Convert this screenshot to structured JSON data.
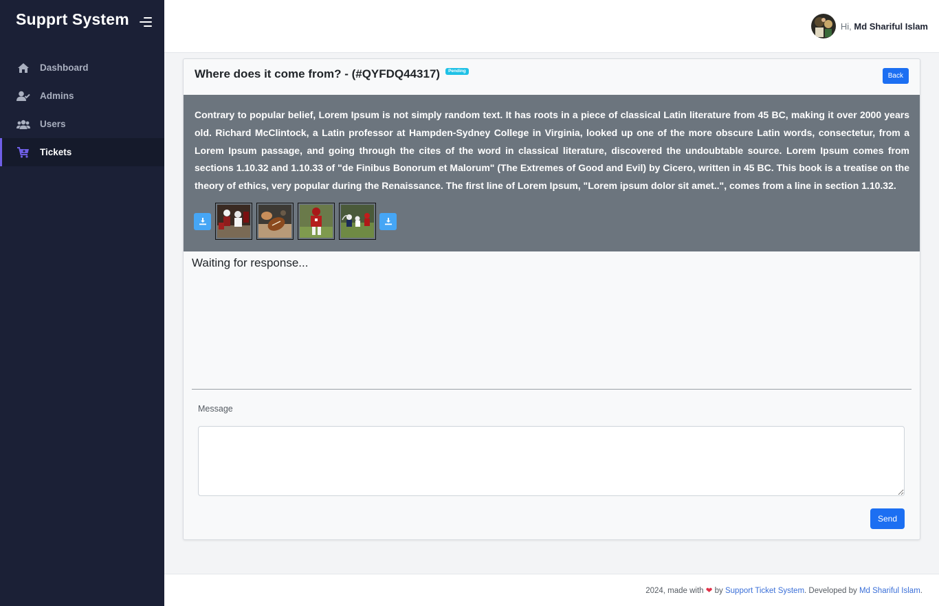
{
  "app": {
    "brand": "Supprt System",
    "colors": {
      "sidebar": "#1b2036",
      "accent": "#6f5fe6",
      "primary": "#1c6ff2",
      "badge": "#1fc1e6"
    }
  },
  "sidebar": {
    "items": [
      {
        "label": "Dashboard",
        "icon": "home-icon",
        "active": false
      },
      {
        "label": "Admins",
        "icon": "user-check-icon",
        "active": false
      },
      {
        "label": "Users",
        "icon": "users-icon",
        "active": false
      },
      {
        "label": "Tickets",
        "icon": "cart-icon",
        "active": true
      }
    ]
  },
  "header": {
    "greeting": "Hi,",
    "user_name": "Md Shariful Islam"
  },
  "ticket": {
    "title": "Where does it come from? - (#QYFDQ44317)",
    "status": "Pending",
    "back_label": "Back",
    "description": "Contrary to popular belief, Lorem Ipsum is not simply random text. It has roots in a piece of classical Latin literature from 45 BC, making it over 2000 years old. Richard McClintock, a Latin professor at Hampden-Sydney College in Virginia, looked up one of the more obscure Latin words, consectetur, from a Lorem Ipsum passage, and going through the cites of the word in classical literature, discovered the undoubtable source. Lorem Ipsum comes from sections 1.10.32 and 1.10.33 of \"de Finibus Bonorum et Malorum\" (The Extremes of Good and Evil) by Cicero, written in 45 BC. This book is a treatise on the theory of ethics, very popular during the Renaissance. The first line of Lorem Ipsum, \"Lorem ipsum dolor sit amet..\", comes from a line in section 1.10.32.",
    "attachments": [
      {
        "icon": "football-players-thumbnail"
      },
      {
        "icon": "football-ball-thumbnail"
      },
      {
        "icon": "football-player-thumbnail"
      },
      {
        "icon": "football-field-thumbnail"
      }
    ],
    "waiting_text": "Waiting for response...",
    "message_label": "Message",
    "message_value": "",
    "send_label": "Send"
  },
  "footer": {
    "prefix": "2024, made with",
    "by": "by",
    "link1": "Support Ticket System",
    "middle": ". Developed by",
    "link2": "Md Shariful Islam",
    "suffix": "."
  }
}
